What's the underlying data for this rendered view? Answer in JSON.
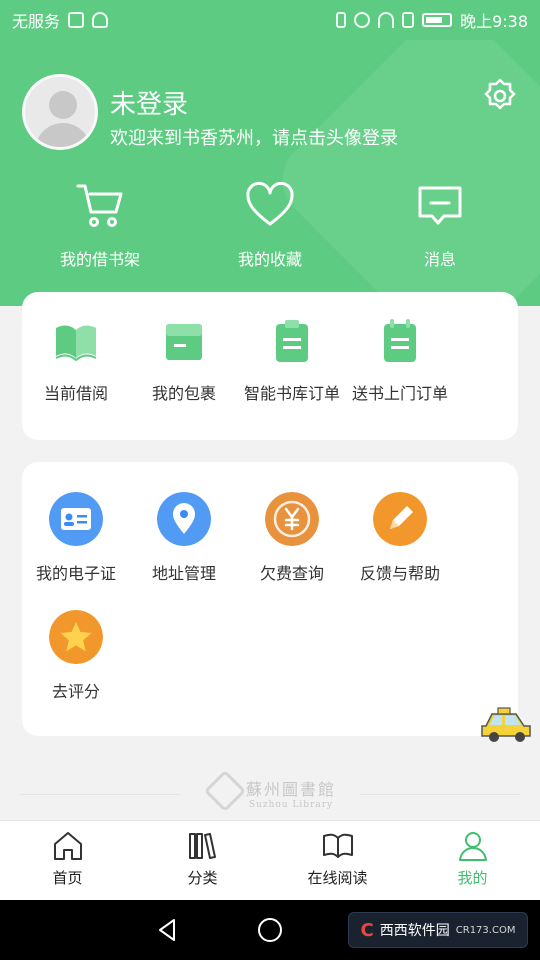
{
  "status_bar": {
    "carrier": "无服务",
    "time": "晚上9:38"
  },
  "user": {
    "title": "未登录",
    "subtitle": "欢迎来到书香苏州，请点击头像登录"
  },
  "top_actions": [
    {
      "label": "我的借书架",
      "icon": "cart-icon"
    },
    {
      "label": "我的收藏",
      "icon": "heart-icon"
    },
    {
      "label": "消息",
      "icon": "message-icon"
    }
  ],
  "grid1": [
    {
      "label": "当前借阅",
      "icon": "open-book-icon"
    },
    {
      "label": "我的包裹",
      "icon": "package-icon"
    },
    {
      "label": "智能书库订单",
      "icon": "clipboard-icon"
    },
    {
      "label": "送书上门订单",
      "icon": "order-notebook-icon"
    }
  ],
  "grid2": [
    {
      "label": "我的电子证",
      "icon": "id-card-icon",
      "color": "#3b8cf0"
    },
    {
      "label": "地址管理",
      "icon": "location-pin-icon",
      "color": "#3b8cf0"
    },
    {
      "label": "欠费查询",
      "icon": "yen-coin-icon",
      "color": "#e9923e"
    },
    {
      "label": "反馈与帮助",
      "icon": "pencil-icon",
      "color": "#f1972b"
    },
    {
      "label": "去评分",
      "icon": "star-icon",
      "color": "#f1972b"
    }
  ],
  "footer": {
    "logo_text": "蘇州圖書館",
    "logo_sub": "Suzhou Library"
  },
  "tabs": [
    {
      "label": "首页",
      "icon": "home-icon",
      "active": false
    },
    {
      "label": "分类",
      "icon": "books-category-icon",
      "active": false
    },
    {
      "label": "在线阅读",
      "icon": "open-book-outline-icon",
      "active": false
    },
    {
      "label": "我的",
      "icon": "person-icon",
      "active": true
    }
  ],
  "watermark": {
    "text": "西西软件园",
    "sub": "CR173.COM"
  },
  "colors": {
    "brand_green": "#5dcc82",
    "active_tab": "#3fbf6b"
  }
}
